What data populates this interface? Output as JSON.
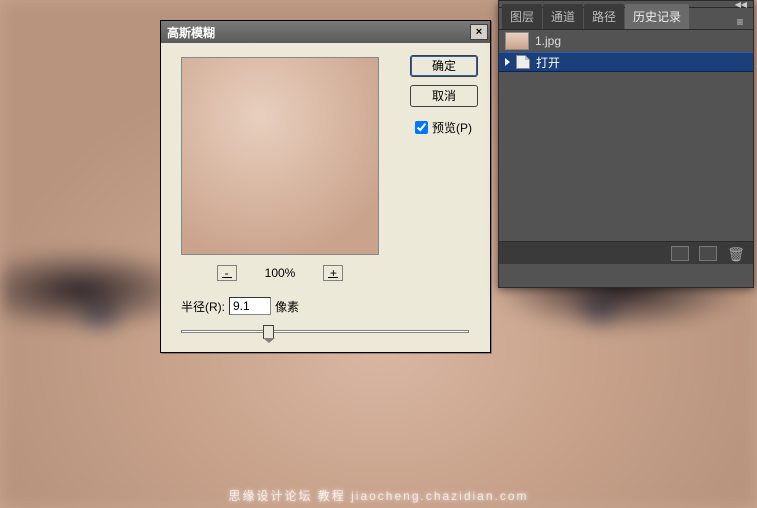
{
  "dialog": {
    "title": "高斯模糊",
    "ok_label": "确定",
    "cancel_label": "取消",
    "preview_label": "预览(P)",
    "zoom_level": "100%",
    "zoom_minus": "-",
    "zoom_plus": "+",
    "radius_label": "半径(R):",
    "radius_value": "9.1",
    "radius_unit": "像素",
    "close_glyph": "×"
  },
  "panel": {
    "tabs": [
      "图层",
      "通道",
      "路径",
      "历史记录"
    ],
    "active_tab_index": 3,
    "file_name": "1.jpg",
    "history": {
      "items": [
        {
          "label": "打开"
        }
      ]
    },
    "menu_glyph": "▾",
    "arrows_glyph": "◀◀"
  },
  "watermark": "思缘设计论坛  教程  jiaocheng.chazidian.com"
}
